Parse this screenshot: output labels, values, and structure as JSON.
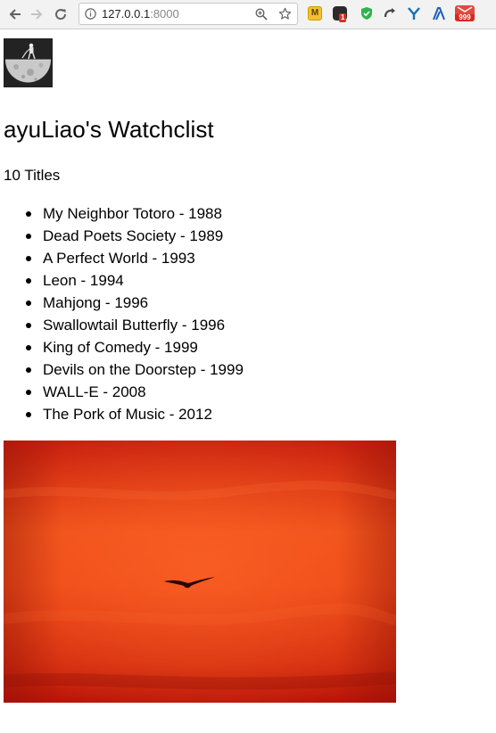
{
  "browser": {
    "url_host": "127.0.0.1",
    "url_port": ":8000",
    "extensions": [
      {
        "name": "m-extension-icon",
        "glyph": "M"
      },
      {
        "name": "notification-extension-icon",
        "badge": "1"
      },
      {
        "name": "shield-extension-icon"
      },
      {
        "name": "arrow-extension-icon"
      },
      {
        "name": "y-extension-icon"
      },
      {
        "name": "lambda-extension-icon"
      },
      {
        "name": "mail-extension-icon",
        "badge": "999"
      }
    ]
  },
  "page": {
    "title": "ayuLiao's Watchclist",
    "count_text": "10 Titles",
    "movies": [
      {
        "text": "My Neighbor Totoro - 1988"
      },
      {
        "text": "Dead Poets Society - 1989"
      },
      {
        "text": "A Perfect World - 1993"
      },
      {
        "text": "Leon - 1994"
      },
      {
        "text": "Mahjong - 1996"
      },
      {
        "text": "Swallowtail Butterfly - 1996"
      },
      {
        "text": "King of Comedy - 1999"
      },
      {
        "text": "Devils on the Doorstep - 1999"
      },
      {
        "text": "WALL-E - 2008"
      },
      {
        "text": "The Pork of Music - 2012"
      }
    ]
  },
  "colors": {
    "chrome_bg": "#f2f2f2",
    "photo_sky_top": "#c8200f",
    "photo_sky_mid": "#f0501a",
    "photo_sky_bottom": "#b81408"
  }
}
